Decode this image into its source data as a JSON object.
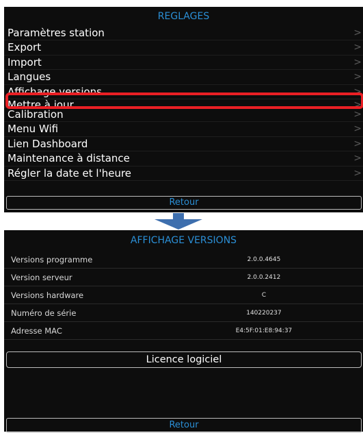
{
  "settings_screen": {
    "title": "REGLAGES",
    "items": [
      {
        "label": "Paramètres station"
      },
      {
        "label": "Export"
      },
      {
        "label": "Import"
      },
      {
        "label": "Langues"
      },
      {
        "label": "Affichage versions"
      },
      {
        "label": "Mettre à jour"
      },
      {
        "label": "Calibration"
      },
      {
        "label": "Menu Wifi"
      },
      {
        "label": "Lien Dashboard"
      },
      {
        "label": "Maintenance à distance"
      },
      {
        "label": "Régler la date et l'heure"
      }
    ],
    "back_label": "Retour",
    "highlight_color": "#ea1f24",
    "accent_color": "#2b8fd6"
  },
  "versions_screen": {
    "title": "AFFICHAGE VERSIONS",
    "rows": [
      {
        "label": "Versions programme",
        "value": "2.0.0.4645"
      },
      {
        "label": "Version serveur",
        "value": "2.0.0.2412"
      },
      {
        "label": "Versions hardware",
        "value": "C"
      },
      {
        "label": "Numéro de série",
        "value": "140220237"
      },
      {
        "label": "Adresse MAC",
        "value": "E4:5F:01:E8:94:37"
      }
    ],
    "licence_label": "Licence logiciel",
    "back_label": "Retour"
  },
  "icons": {
    "chevron": "chevron-right-icon",
    "arrow": "arrow-down-icon"
  }
}
